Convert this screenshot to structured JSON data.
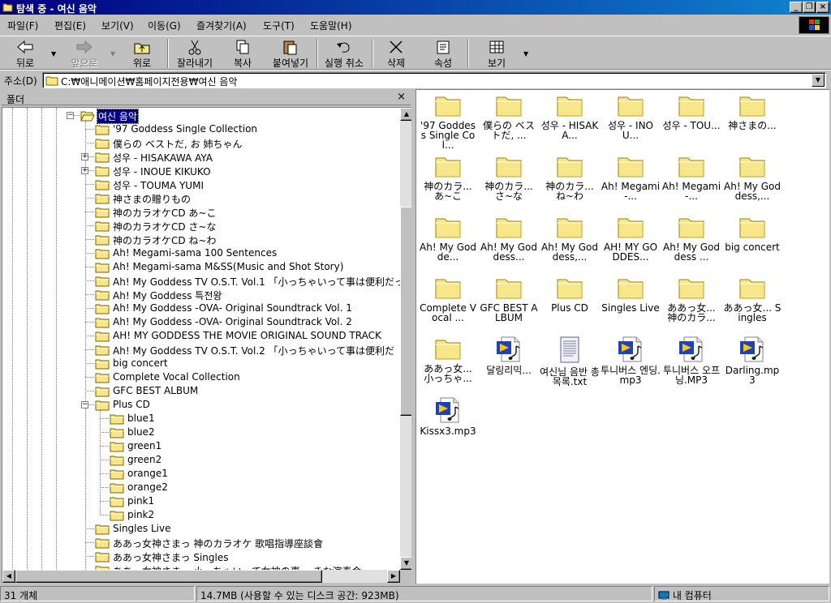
{
  "window": {
    "title": "탐색 중 - 여신 음악",
    "icon": "folder-open-icon"
  },
  "menu": [
    "파일(F)",
    "편집(E)",
    "보기(V)",
    "이동(G)",
    "즐겨찾기(A)",
    "도구(T)",
    "도움말(H)"
  ],
  "toolbar": {
    "back": "뒤로",
    "forward": "앞으로",
    "up": "위로",
    "cut": "잘라내기",
    "copy": "복사",
    "paste": "붙여넣기",
    "undo": "실행 취소",
    "delete": "삭제",
    "properties": "속성",
    "views": "보기"
  },
  "address": {
    "label": "주소(D)",
    "value": "C:₩애니메이션₩홈페이지전용₩여신 음악"
  },
  "folders_pane": {
    "title": "폴더",
    "close": "×"
  },
  "tree": [
    {
      "label": "여신 음악",
      "level": 0,
      "selected": true,
      "expanded": true,
      "open": true
    },
    {
      "label": "'97 Goddess Single Collection",
      "level": 1
    },
    {
      "label": "僕らの ベストだ, お 姉ちゃん",
      "level": 1
    },
    {
      "label": "성우 - HISAKAWA AYA",
      "level": 1,
      "expandable": true
    },
    {
      "label": "성우 - INOUE KIKUKO",
      "level": 1,
      "expandable": true
    },
    {
      "label": "성우 - TOUMA YUMI",
      "level": 1
    },
    {
      "label": "神さまの贈りもの",
      "level": 1
    },
    {
      "label": "神のカラオケCD あ~こ",
      "level": 1
    },
    {
      "label": "神のカラオケCD さ~な",
      "level": 1
    },
    {
      "label": "神のカラオケCD ね~わ",
      "level": 1
    },
    {
      "label": "Ah! Megami-sama 100 Sentences",
      "level": 1
    },
    {
      "label": "Ah! Megami-sama M&SS(Music and Shot Story)",
      "level": 1
    },
    {
      "label": "Ah! My Goddess  TV O.S.T. Vol.1 「小っちゃいって事は便利だっ",
      "level": 1
    },
    {
      "label": "Ah! My Goddess 특전왕",
      "level": 1
    },
    {
      "label": "Ah! My Goddess -OVA- Original Soundtrack Vol. 1",
      "level": 1
    },
    {
      "label": "Ah! My Goddess -OVA- Original Soundtrack Vol. 2",
      "level": 1
    },
    {
      "label": "AH! MY GODDESS THE MOVIE ORIGINAL SOUND TRACK",
      "level": 1
    },
    {
      "label": "Ah! My Goddess TV O.S.T. Vol.2 「小っちゃいって事は便利だ",
      "level": 1
    },
    {
      "label": "big concert",
      "level": 1
    },
    {
      "label": "Complete Vocal Collection",
      "level": 1
    },
    {
      "label": "GFC BEST ALBUM",
      "level": 1
    },
    {
      "label": "Plus CD",
      "level": 1,
      "expanded": true
    },
    {
      "label": "blue1",
      "level": 2
    },
    {
      "label": "blue2",
      "level": 2
    },
    {
      "label": "green1",
      "level": 2
    },
    {
      "label": "green2",
      "level": 2
    },
    {
      "label": "orange1",
      "level": 2
    },
    {
      "label": "orange2",
      "level": 2
    },
    {
      "label": "pink1",
      "level": 2
    },
    {
      "label": "pink2",
      "level": 2
    },
    {
      "label": "Singles Live",
      "level": 1
    },
    {
      "label": "ああっ女神さまっ 神のカラオケ 歌唱指導座談會",
      "level": 1
    },
    {
      "label": "ああっ女神さまっ Singles",
      "level": 1
    },
    {
      "label": "ああっ女神さまっ 小っちゃいって女神の事 ～きな演奏会",
      "level": 1
    }
  ],
  "files": [
    {
      "label": "'97 Goddess Single Col...",
      "type": "folder"
    },
    {
      "label": "僕らの ベストだ, ...",
      "type": "folder"
    },
    {
      "label": "성우 - HISAKA...",
      "type": "folder"
    },
    {
      "label": "성우 - INOU...",
      "type": "folder"
    },
    {
      "label": "성우 - TOU...",
      "type": "folder"
    },
    {
      "label": "神さまの...",
      "type": "folder"
    },
    {
      "label": "神のカラ... あ~こ",
      "type": "folder"
    },
    {
      "label": "神のカラ... さ~な",
      "type": "folder"
    },
    {
      "label": "神のカラ... ね~わ",
      "type": "folder"
    },
    {
      "label": "Ah! Megami-...",
      "type": "folder"
    },
    {
      "label": "Ah! Megami-...",
      "type": "folder"
    },
    {
      "label": "Ah! My Goddess,...",
      "type": "folder"
    },
    {
      "label": "Ah! My Godde...",
      "type": "folder"
    },
    {
      "label": "Ah! My Goddess...",
      "type": "folder"
    },
    {
      "label": "Ah! My Goddess,...",
      "type": "folder"
    },
    {
      "label": "AH! MY GODDES...",
      "type": "folder"
    },
    {
      "label": "Ah! My Goddess ...",
      "type": "folder"
    },
    {
      "label": "big concert",
      "type": "folder"
    },
    {
      "label": "Complete Vocal ...",
      "type": "folder"
    },
    {
      "label": "GFC BEST ALBUM",
      "type": "folder"
    },
    {
      "label": "Plus CD",
      "type": "folder"
    },
    {
      "label": "Singles Live",
      "type": "folder"
    },
    {
      "label": "ああっ女... 神のカラ...",
      "type": "folder"
    },
    {
      "label": "ああっ女... Singles",
      "type": "folder"
    },
    {
      "label": "ああっ女... 小っちゃ...",
      "type": "folder"
    },
    {
      "label": "달링리믹...",
      "type": "audio"
    },
    {
      "label": "여신님 음반 총목록.txt",
      "type": "text"
    },
    {
      "label": "투니버스 엔딩.mp3",
      "type": "audio"
    },
    {
      "label": "투니버스 오프닝.MP3",
      "type": "audio"
    },
    {
      "label": "Darling.mp3",
      "type": "audio"
    },
    {
      "label": "Kissx3.mp3",
      "type": "audio"
    }
  ],
  "status": {
    "count": "31 개체",
    "size": "14.7MB (사용할 수 있는 디스크 공간: 923MB)",
    "location": "내 컴퓨터"
  },
  "colors": {
    "titlebar": "#000080",
    "selection": "#000080",
    "folder": "#f8e78a",
    "face": "#c0c0c0"
  }
}
